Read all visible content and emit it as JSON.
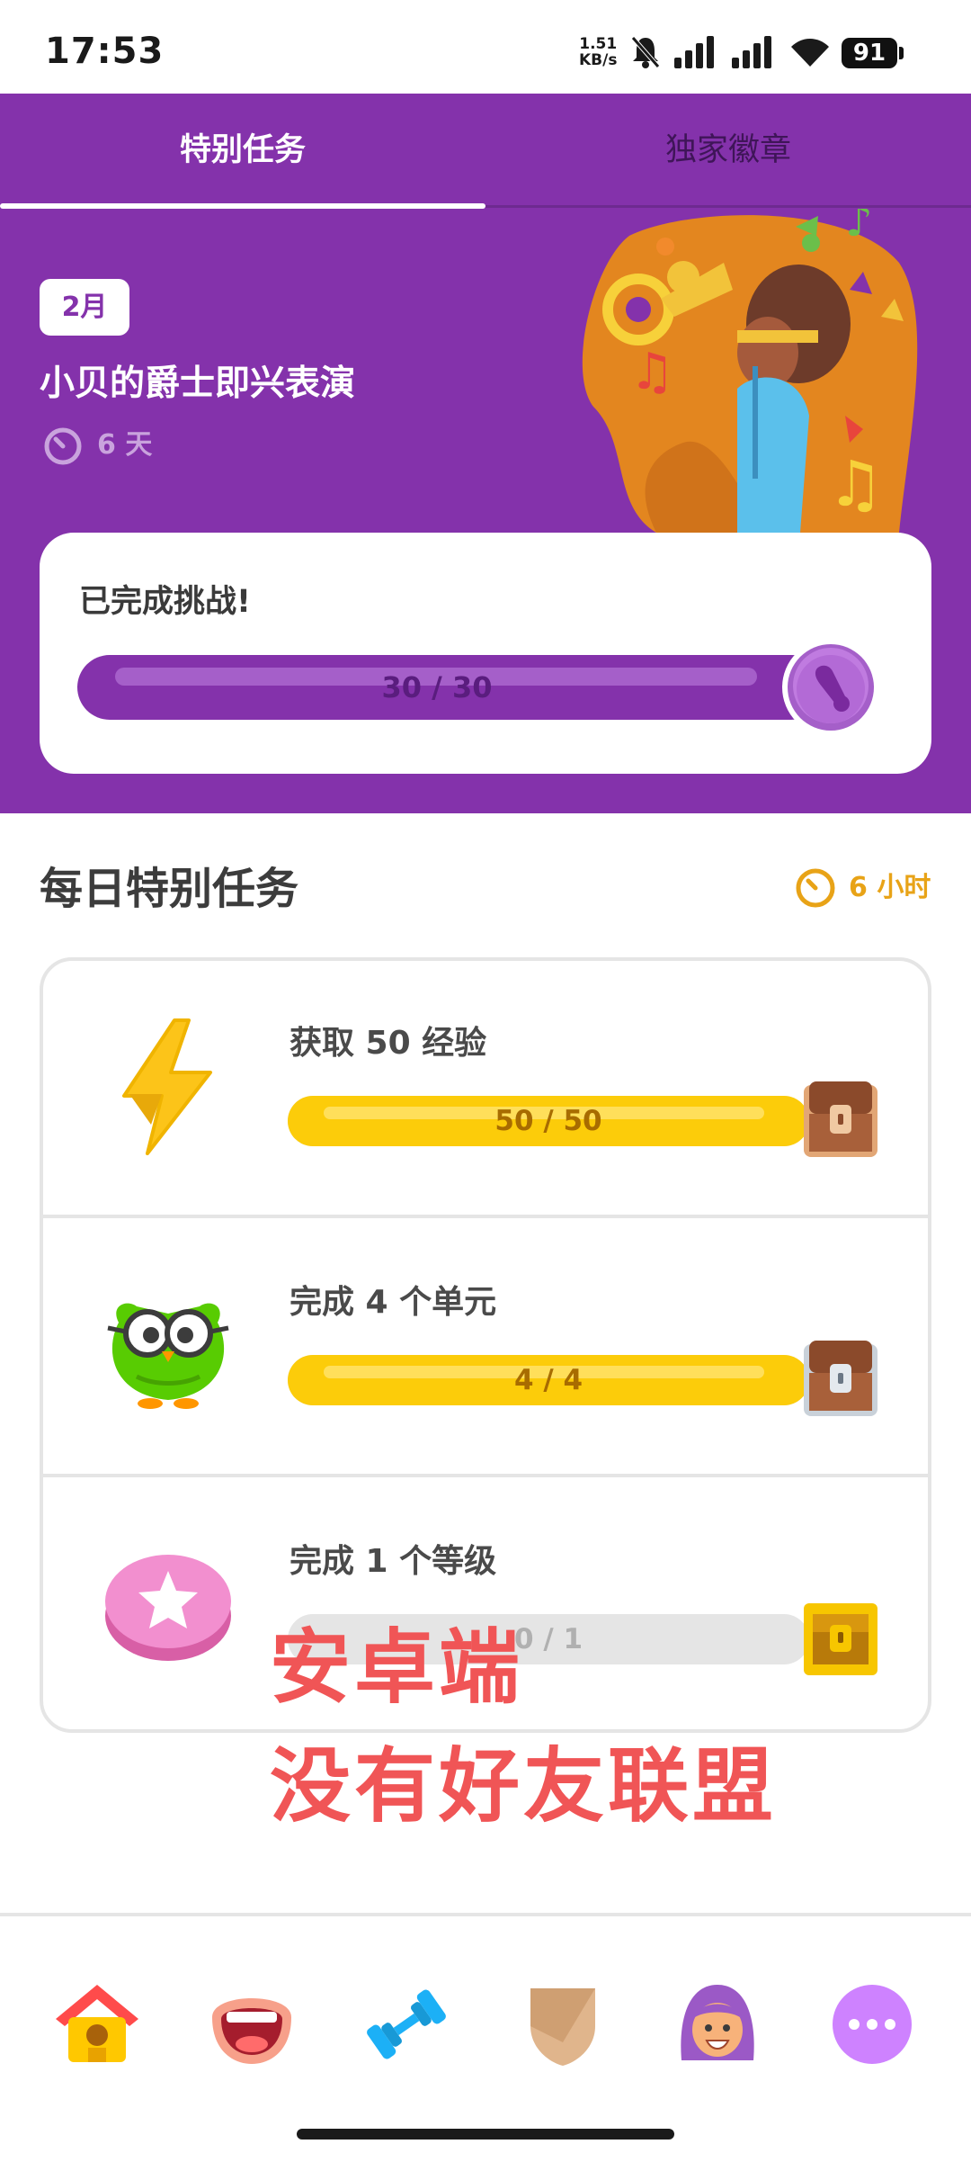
{
  "status_bar": {
    "time": "17:53",
    "net_speed_value": "1.51",
    "net_speed_unit": "KB/s",
    "battery": "91"
  },
  "tabs": [
    {
      "label": "特别任务",
      "active": true
    },
    {
      "label": "独家徽章",
      "active": false
    }
  ],
  "event": {
    "month_badge": "2月",
    "title": "小贝的爵士即兴表演",
    "days_left": "6 天"
  },
  "challenge": {
    "title": "已完成挑战!",
    "progress_text": "30 / 30",
    "progress": 1.0
  },
  "daily": {
    "title": "每日特别任务",
    "timer": "6 小时",
    "quests": [
      {
        "label": "获取 50 经验",
        "progress_text": "50 / 50",
        "progress": 1.0,
        "icon": "lightning-icon",
        "chest": "bronze-chest"
      },
      {
        "label": "完成 4 个单元",
        "progress_text": "4 / 4",
        "progress": 1.0,
        "icon": "owl-glasses-icon",
        "chest": "silver-chest"
      },
      {
        "label": "完成 1 个等级",
        "progress_text": "0 / 1",
        "progress": 0.0,
        "icon": "pink-star-button-icon",
        "chest": "gold-chest"
      }
    ]
  },
  "overlay": {
    "line1": "安卓端",
    "line2": "没有好友联盟"
  },
  "colors": {
    "purple": "#8432ab",
    "yellow": "#fccc0a",
    "overlay_red": "#f05556",
    "timer_orange": "#e8a317"
  },
  "bottom_nav": [
    {
      "icon": "home-icon"
    },
    {
      "icon": "speaking-mouth-icon"
    },
    {
      "icon": "dumbbell-icon"
    },
    {
      "icon": "shield-icon"
    },
    {
      "icon": "profile-avatar-icon"
    },
    {
      "icon": "more-icon"
    }
  ]
}
